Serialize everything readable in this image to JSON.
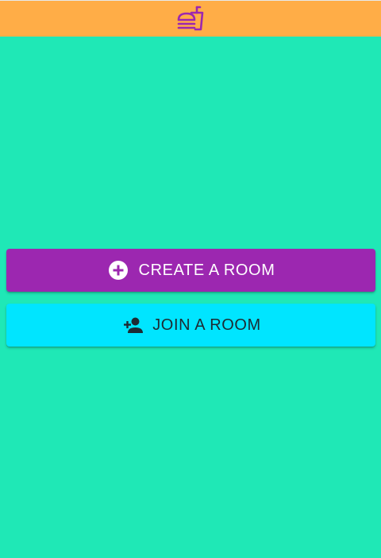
{
  "app": {
    "logo_icon": "fastfood-icon",
    "colors": {
      "topbar": "#ffad47",
      "background": "#1fe8b6",
      "logo": "#9c27b0",
      "create_button": "#9c27b0",
      "join_button": "#00e5ff"
    }
  },
  "actions": {
    "create": {
      "label": "CREATE A ROOM",
      "icon": "add-circle-icon"
    },
    "join": {
      "label": "JOIN A ROOM",
      "icon": "person-add-icon"
    }
  }
}
